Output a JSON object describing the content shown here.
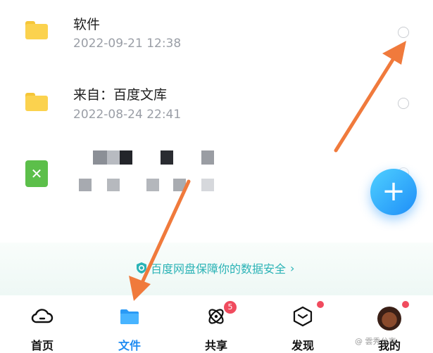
{
  "files": [
    {
      "name": "软件",
      "date": "2022-09-21  12:38",
      "icon": "folder-icon"
    },
    {
      "name": "来自：百度文库",
      "date": "2022-08-24  22:41",
      "icon": "folder-icon"
    }
  ],
  "excel_file": {
    "icon": "excel-icon",
    "glyph": "✕"
  },
  "fab": {
    "glyph": "+"
  },
  "banner": {
    "text": "百度网盘保障你的数据安全",
    "chevron": "›"
  },
  "tabs": [
    {
      "label": "首页",
      "icon": "home-cloud-icon",
      "active": false
    },
    {
      "label": "文件",
      "icon": "folder-icon",
      "active": true
    },
    {
      "label": "共享",
      "icon": "share-orbit-icon",
      "active": false,
      "badge": "5"
    },
    {
      "label": "发现",
      "icon": "discover-cube-icon",
      "active": false
    },
    {
      "label": "我的",
      "icon": "avatar",
      "active": false
    }
  ],
  "watermark": "@ 雲秀分享",
  "colors": {
    "accent": "#1f8cf2",
    "banner_text": "#2bb3b6",
    "badge": "#f04b5e",
    "arrow": "#f07a3c"
  }
}
